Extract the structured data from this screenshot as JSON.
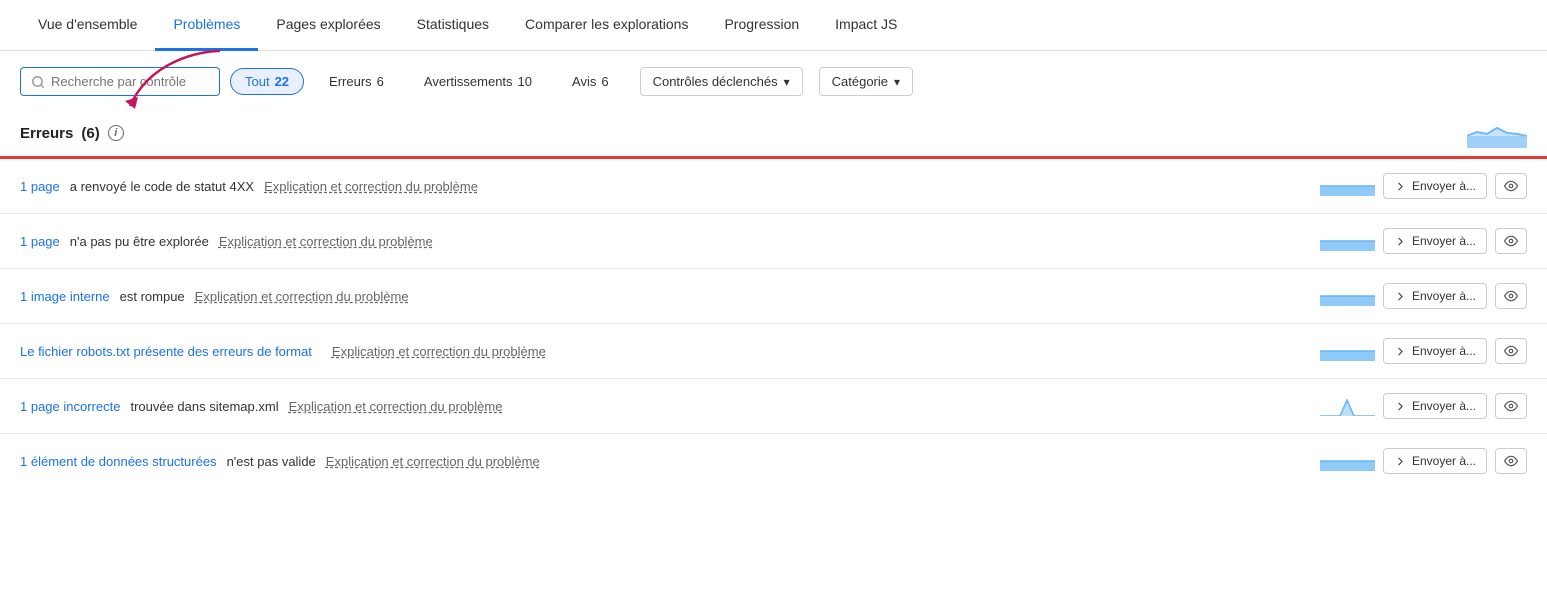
{
  "nav": {
    "items": [
      {
        "label": "Vue d'ensemble",
        "active": false
      },
      {
        "label": "Problèmes",
        "active": true
      },
      {
        "label": "Pages explorées",
        "active": false
      },
      {
        "label": "Statistiques",
        "active": false
      },
      {
        "label": "Comparer les explorations",
        "active": false
      },
      {
        "label": "Progression",
        "active": false
      },
      {
        "label": "Impact JS",
        "active": false
      }
    ]
  },
  "toolbar": {
    "search_placeholder": "Recherche par contrôle",
    "filters": [
      {
        "label": "Tout",
        "count": "22",
        "active": true
      },
      {
        "label": "Erreurs",
        "count": "6",
        "active": false
      },
      {
        "label": "Avertissements",
        "count": "10",
        "active": false
      },
      {
        "label": "Avis",
        "count": "6",
        "active": false
      }
    ],
    "dropdown1_label": "Contrôles déclenchés",
    "dropdown2_label": "Catégorie"
  },
  "section": {
    "title": "Erreurs",
    "count": "(6)"
  },
  "issues": [
    {
      "link_text": "1 page",
      "description": " a renvoyé le code de statut 4XX",
      "fix_label": "Explication et correction du problème",
      "chart_type": "flat",
      "send_label": "Envoyer à..."
    },
    {
      "link_text": "1 page",
      "description": " n'a pas pu être explorée",
      "fix_label": "Explication et correction du problème",
      "chart_type": "flat",
      "send_label": "Envoyer à..."
    },
    {
      "link_text": "1 image interne",
      "description": " est rompue",
      "fix_label": "Explication et correction du problème",
      "chart_type": "flat",
      "send_label": "Envoyer à..."
    },
    {
      "link_text": "Le fichier robots.txt présente des erreurs de format",
      "description": "",
      "fix_label": "Explication et correction du problème",
      "chart_type": "flat",
      "send_label": "Envoyer à..."
    },
    {
      "link_text": "1 page incorrecte",
      "description": " trouvée dans sitemap.xml",
      "fix_label": "Explication et correction du problème",
      "chart_type": "peak",
      "send_label": "Envoyer à..."
    },
    {
      "link_text": "1 élément de données structurées",
      "description": " n'est pas valide",
      "fix_label": "Explication et correction du problème",
      "chart_type": "flat",
      "send_label": "Envoyer à..."
    }
  ],
  "colors": {
    "accent": "#1a73e8",
    "error_bar": "#e53935",
    "chart_blue": "#90caf9",
    "chart_blue_dark": "#64b5f6"
  }
}
